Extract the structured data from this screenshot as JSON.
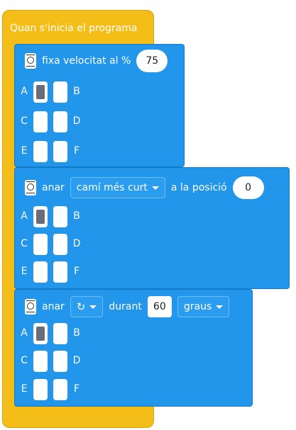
{
  "hat": {
    "label": "Quan s'inicia el programa"
  },
  "block1": {
    "label": "fixa velocitat al %",
    "value": "75",
    "ports": {
      "labels": [
        "A",
        "B",
        "C",
        "D",
        "E",
        "F"
      ],
      "selected": [
        "A"
      ]
    }
  },
  "block2": {
    "label": "anar",
    "dropdown": "camí més curt",
    "label2": "a la posició",
    "value": "0",
    "ports": {
      "labels": [
        "A",
        "B",
        "C",
        "D",
        "E",
        "F"
      ],
      "selected": [
        "A"
      ]
    }
  },
  "block3": {
    "label": "anar",
    "direction_icon": "rotate-clockwise-icon",
    "label2": "durant",
    "value": "60",
    "unit": "graus",
    "ports": {
      "labels": [
        "A",
        "B",
        "C",
        "D",
        "E",
        "F"
      ],
      "selected": [
        "A"
      ]
    }
  },
  "colors": {
    "hat": "#f5bd18",
    "motor_block": "#2196ea"
  }
}
